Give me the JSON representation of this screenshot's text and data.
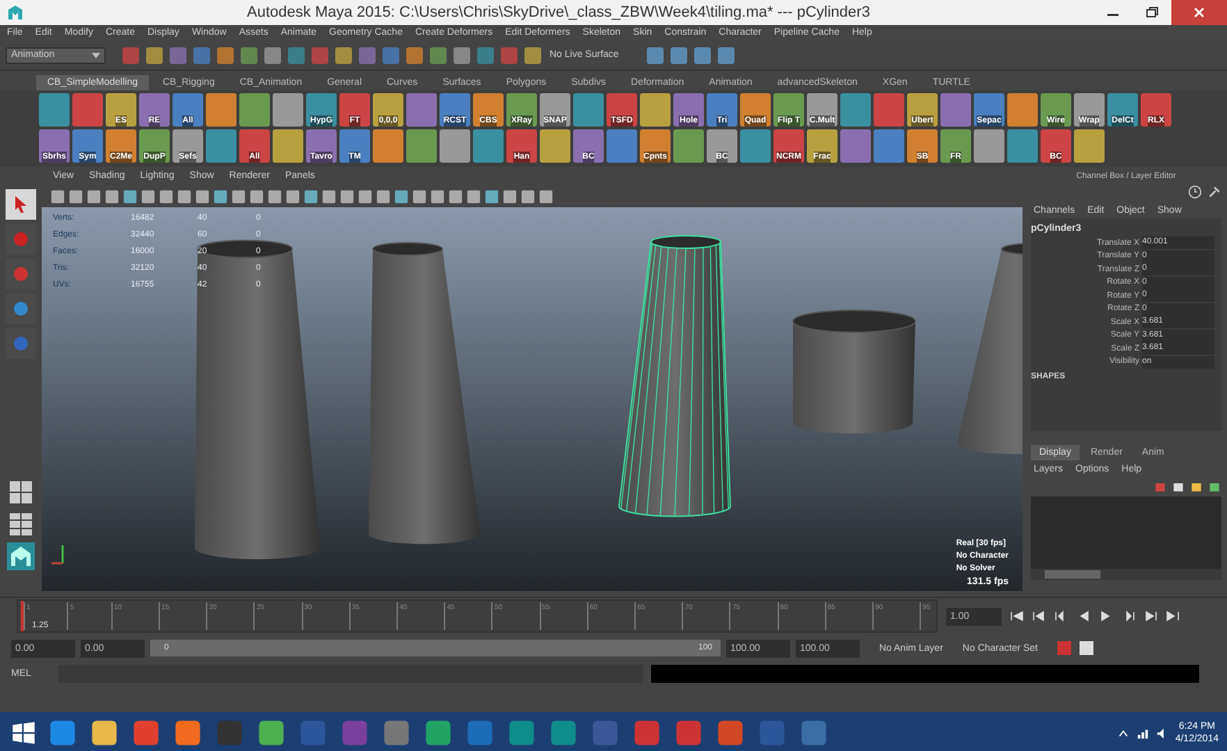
{
  "window": {
    "title": "Autodesk Maya 2015: C:\\Users\\Chris\\SkyDrive\\_class_ZBW\\Week4\\tiling.ma*  ---  pCylinder3"
  },
  "menu_bar": [
    "File",
    "Edit",
    "Modify",
    "Create",
    "Display",
    "Window",
    "Assets",
    "Animate",
    "Geometry Cache",
    "Create Deformers",
    "Edit Deformers",
    "Skeleton",
    "Skin",
    "Constrain",
    "Character",
    "Pipeline Cache",
    "Help"
  ],
  "status_line": {
    "menu_set": "Animation",
    "live_surface": "No Live Surface"
  },
  "shelf_tabs": [
    {
      "label": "CB_SimpleModelling",
      "selected": true
    },
    {
      "label": "CB_Rigging",
      "selected": false
    },
    {
      "label": "CB_Animation",
      "selected": false
    },
    {
      "label": "General",
      "selected": false
    },
    {
      "label": "Curves",
      "selected": false
    },
    {
      "label": "Surfaces",
      "selected": false
    },
    {
      "label": "Polygons",
      "selected": false
    },
    {
      "label": "Subdivs",
      "selected": false
    },
    {
      "label": "Deformation",
      "selected": false
    },
    {
      "label": "Animation",
      "selected": false
    },
    {
      "label": "advancedSkeleton",
      "selected": false
    },
    {
      "label": "XGen",
      "selected": false
    },
    {
      "label": "TURTLE",
      "selected": false
    }
  ],
  "shelf_row_1": [
    {
      "kind": "plain"
    },
    {
      "kind": "plain"
    },
    {
      "kind": "labeled",
      "label": "ES"
    },
    {
      "kind": "labeled",
      "label": "RE"
    },
    {
      "kind": "labeled",
      "label": "All"
    },
    {
      "kind": "plain"
    },
    {
      "kind": "plain"
    },
    {
      "kind": "plain"
    },
    {
      "kind": "labeled",
      "label": "HypG"
    },
    {
      "kind": "labeled",
      "label": "FT"
    },
    {
      "kind": "labeled",
      "label": "0,0,0"
    },
    {
      "kind": "plain"
    },
    {
      "kind": "labeled",
      "label": "RCST"
    },
    {
      "kind": "labeled",
      "label": "CBS"
    },
    {
      "kind": "labeled",
      "label": "XRay"
    },
    {
      "kind": "labeled",
      "label": "SNAP"
    },
    {
      "kind": "plain"
    },
    {
      "kind": "labeled",
      "label": "TSFD"
    },
    {
      "kind": "plain"
    },
    {
      "kind": "labeled",
      "label": "Hole"
    },
    {
      "kind": "labeled",
      "label": "Tri"
    },
    {
      "kind": "labeled",
      "label": "Quad"
    },
    {
      "kind": "labeled",
      "label": "Flip T"
    },
    {
      "kind": "labeled",
      "label": "C.Mult"
    },
    {
      "kind": "plain"
    },
    {
      "kind": "plain"
    },
    {
      "kind": "labeled",
      "label": "Ubert"
    },
    {
      "kind": "plain"
    },
    {
      "kind": "labeled",
      "label": "Sepac"
    },
    {
      "kind": "plain"
    },
    {
      "kind": "labeled",
      "label": "Wire"
    },
    {
      "kind": "labeled",
      "label": "Wrap"
    },
    {
      "kind": "labeled",
      "label": "DelCt"
    },
    {
      "kind": "labeled",
      "label": "RLX"
    }
  ],
  "shelf_row_2": [
    {
      "kind": "labeled",
      "label": "Sbrhs"
    },
    {
      "kind": "labeled",
      "label": "Sym"
    },
    {
      "kind": "labeled",
      "label": "C2Me"
    },
    {
      "kind": "labeled",
      "label": "DupP"
    },
    {
      "kind": "labeled",
      "label": "Sefs"
    },
    {
      "kind": "plain"
    },
    {
      "kind": "labeled",
      "label": "All"
    },
    {
      "kind": "plain"
    },
    {
      "kind": "labeled",
      "label": "Tavro"
    },
    {
      "kind": "labeled",
      "label": "TM"
    },
    {
      "kind": "plain"
    },
    {
      "kind": "plain"
    },
    {
      "kind": "plain"
    },
    {
      "kind": "plain"
    },
    {
      "kind": "labeled",
      "label": "Han"
    },
    {
      "kind": "plain"
    },
    {
      "kind": "labeled",
      "label": "BC"
    },
    {
      "kind": "plain"
    },
    {
      "kind": "labeled",
      "label": "Cpnts"
    },
    {
      "kind": "plain"
    },
    {
      "kind": "labeled",
      "label": "BC"
    },
    {
      "kind": "plain"
    },
    {
      "kind": "labeled",
      "label": "NCRM"
    },
    {
      "kind": "labeled",
      "label": "Frac"
    },
    {
      "kind": "plain"
    },
    {
      "kind": "plain"
    },
    {
      "kind": "labeled",
      "label": "SB"
    },
    {
      "kind": "labeled",
      "label": "FR"
    },
    {
      "kind": "plain"
    },
    {
      "kind": "plain"
    },
    {
      "kind": "labeled",
      "label": "BC"
    },
    {
      "kind": "plain"
    }
  ],
  "tools": [
    {
      "selected": true
    },
    {
      "selected": false
    },
    {
      "selected": false
    },
    {
      "selected": false
    },
    {
      "selected": false
    }
  ],
  "viewport": {
    "menus": [
      "View",
      "Shading",
      "Lighting",
      "Show",
      "Renderer",
      "Panels"
    ],
    "stats": [
      [
        "Verts:",
        "16482",
        "40",
        "0"
      ],
      [
        "Edges:",
        "32440",
        "60",
        "0"
      ],
      [
        "Faces:",
        "16000",
        "20",
        "0"
      ],
      [
        "Tris:",
        "32120",
        "40",
        "0"
      ],
      [
        "UVs:",
        "16755",
        "42",
        "0"
      ]
    ],
    "objects": [
      {
        "selected": false
      },
      {
        "selected": false
      },
      {
        "selected": true
      },
      {
        "selected": false
      },
      {
        "selected": false
      }
    ],
    "hud": [
      "Real [30 fps]",
      "No Character",
      "No Solver"
    ],
    "fps": "131.5 fps"
  },
  "channel_box": {
    "title": "Channel Box / Layer Editor",
    "menus": [
      "Channels",
      "Edit",
      "Object",
      "Show"
    ],
    "object": "pCylinder3",
    "attributes": [
      [
        "Translate X",
        "40.001"
      ],
      [
        "Translate Y",
        "0"
      ],
      [
        "Translate Z",
        "0"
      ],
      [
        "Rotate X",
        "0"
      ],
      [
        "Rotate Y",
        "0"
      ],
      [
        "Rotate Z",
        "0"
      ],
      [
        "Scale X",
        "3.681"
      ],
      [
        "Scale Y",
        "3.681"
      ],
      [
        "Scale Z",
        "3.681"
      ],
      [
        "Visibility",
        "on"
      ]
    ],
    "shapes": "SHAPES"
  },
  "layer_editor": {
    "tabs": [
      {
        "label": "Display",
        "selected": true
      },
      {
        "label": "Render",
        "selected": false
      },
      {
        "label": "Anim",
        "selected": false
      }
    ],
    "menus": [
      "Layers",
      "Options",
      "Help"
    ]
  },
  "time_slider": {
    "ticks": [
      "1",
      "5",
      "10",
      "15",
      "20",
      "25",
      "30",
      "35",
      "40",
      "45",
      "50",
      "55",
      "60",
      "65",
      "70",
      "75",
      "80",
      "85",
      "90",
      "95"
    ],
    "current": "1.25",
    "level": 0.003,
    "current_field": "1.00"
  },
  "range_slider": {
    "level": 1,
    "start": "0.00",
    "start_range": "0.00",
    "range_start": "0",
    "range_end": "100",
    "end_range": "100.00",
    "end": "100.00",
    "anim_layer": "No Anim Layer",
    "character_set": "No Character Set"
  },
  "command_line": {
    "language": "MEL"
  },
  "taskbar": {
    "time": "6:24 PM",
    "date": "4/12/2014"
  }
}
